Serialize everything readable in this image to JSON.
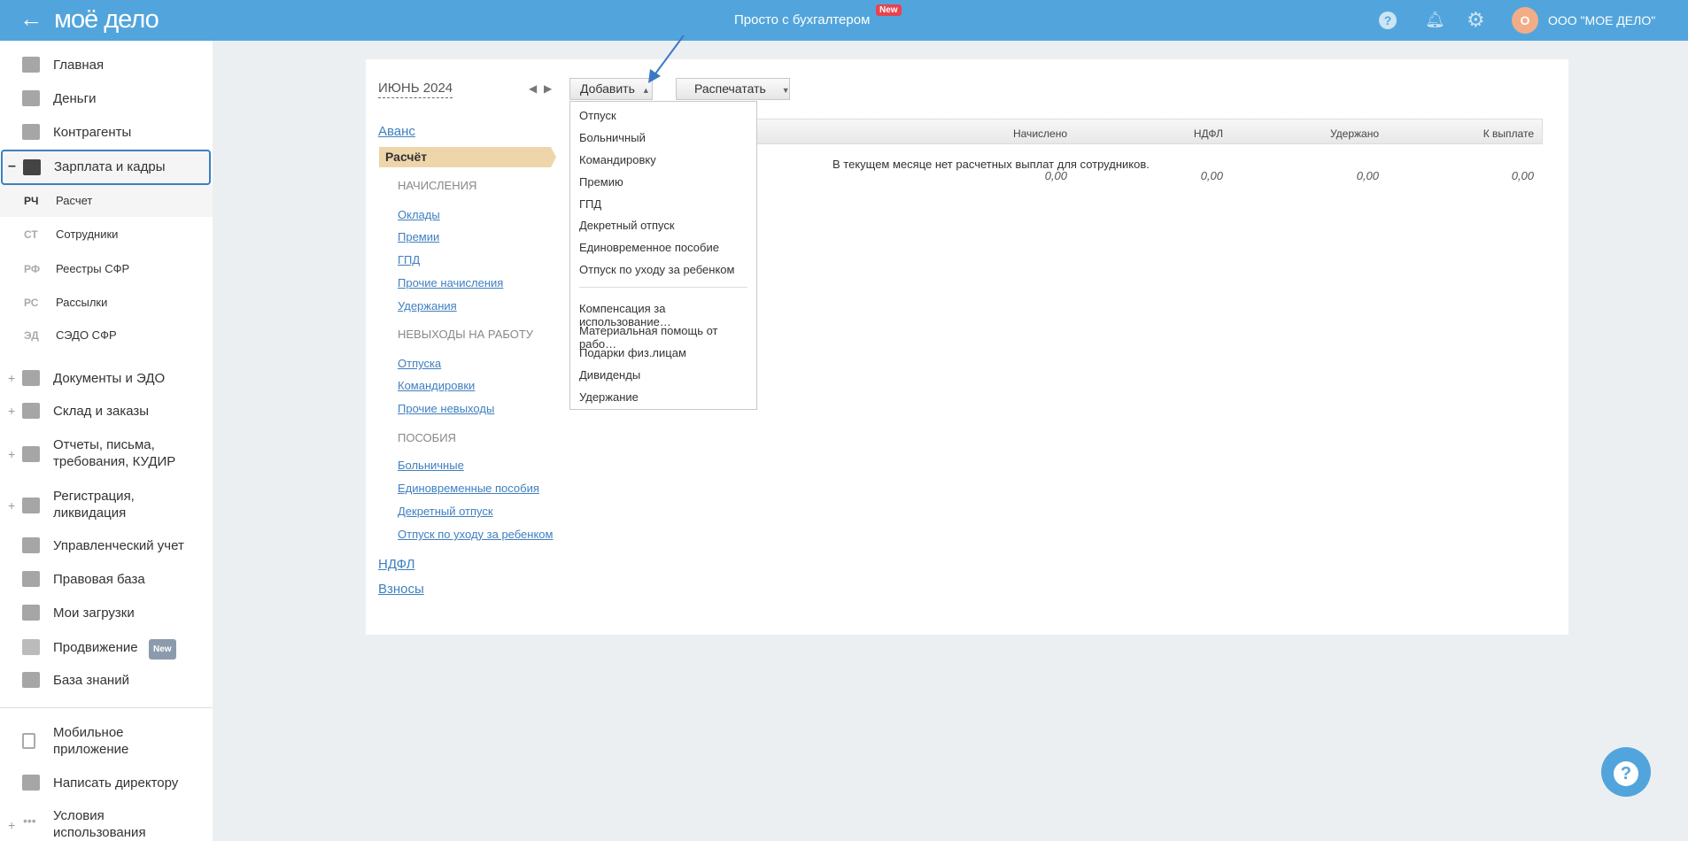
{
  "header": {
    "logo": "моё дело",
    "center_text": "Просто с бухгалтером",
    "center_badge": "New",
    "avatar_letter": "О",
    "company": "ООО \"МОЕ ДЕЛО\""
  },
  "sidebar": {
    "items": [
      {
        "label": "Главная"
      },
      {
        "label": "Деньги"
      },
      {
        "label": "Контрагенты"
      },
      {
        "label": "Зарплата и кадры",
        "expanded": true
      }
    ],
    "sub_items": [
      {
        "code": "РЧ",
        "label": "Расчет",
        "active": true
      },
      {
        "code": "СТ",
        "label": "Сотрудники"
      },
      {
        "code": "РФ",
        "label": "Реестры СФР"
      },
      {
        "code": "РС",
        "label": "Рассылки"
      },
      {
        "code": "ЭД",
        "label": "СЭДО СФР"
      }
    ],
    "items2": [
      {
        "label": "Документы и ЭДО"
      },
      {
        "label": "Склад и заказы"
      },
      {
        "label": "Отчеты, письма,",
        "label2": "требования, КУДИР"
      },
      {
        "label": "Регистрация,",
        "label2": "ликвидация"
      },
      {
        "label": "Управленческий учет"
      },
      {
        "label": "Правовая база"
      },
      {
        "label": "Мои загрузки"
      },
      {
        "label": "Продвижение",
        "badge": "New"
      },
      {
        "label": "База знаний"
      }
    ],
    "bottom": [
      {
        "label": "Мобильное",
        "label2": "приложение"
      },
      {
        "label": "Написать директору"
      },
      {
        "label": "Условия",
        "label2": "использования"
      }
    ]
  },
  "main": {
    "period": "ИЮНЬ 2024",
    "add_button": "Добавить",
    "print_button": "Распечатать",
    "add_menu": [
      "Отпуск",
      "Больничный",
      "Командировку",
      "Премию",
      "ГПД",
      "Декретный отпуск",
      "Единовременное пособие",
      "Отпуск по уходу за ребенком"
    ],
    "add_menu2": [
      "Компенсация за использование…",
      "Материальная помощь от рабо…",
      "Подарки физ.лицам",
      "Дивиденды",
      "Удержание"
    ],
    "nav": {
      "avans": "Аванс",
      "raschet": "Расчёт",
      "cap1": "НАЧИСЛЕНИЯ",
      "links1": [
        "Оклады",
        "Премии",
        "ГПД",
        "Прочие начисления",
        "Удержания"
      ],
      "cap2": "НЕВЫХОДЫ НА РАБОТУ",
      "links2": [
        "Отпуска",
        "Командировки",
        "Прочие невыходы"
      ],
      "cap3": "ПОСОБИЯ",
      "links3": [
        "Больничные",
        "Единовременные пособия",
        "Декретный отпуск",
        "Отпуск по уходу за ребенком"
      ],
      "ndfl": "НДФЛ",
      "vznosy": "Взносы"
    },
    "table": {
      "headers": [
        "Начислено",
        "НДФЛ",
        "Удержано",
        "К выплате"
      ],
      "empty_message": "В текущем месяце нет расчетных выплат для сотрудников.",
      "totals": [
        "0,00",
        "0,00",
        "0,00",
        "0,00"
      ]
    }
  },
  "colors": {
    "header": "#52a5dc",
    "active_tab": "#efd5aa",
    "link": "#3f7fc0",
    "avatar": "#f2ad87"
  }
}
